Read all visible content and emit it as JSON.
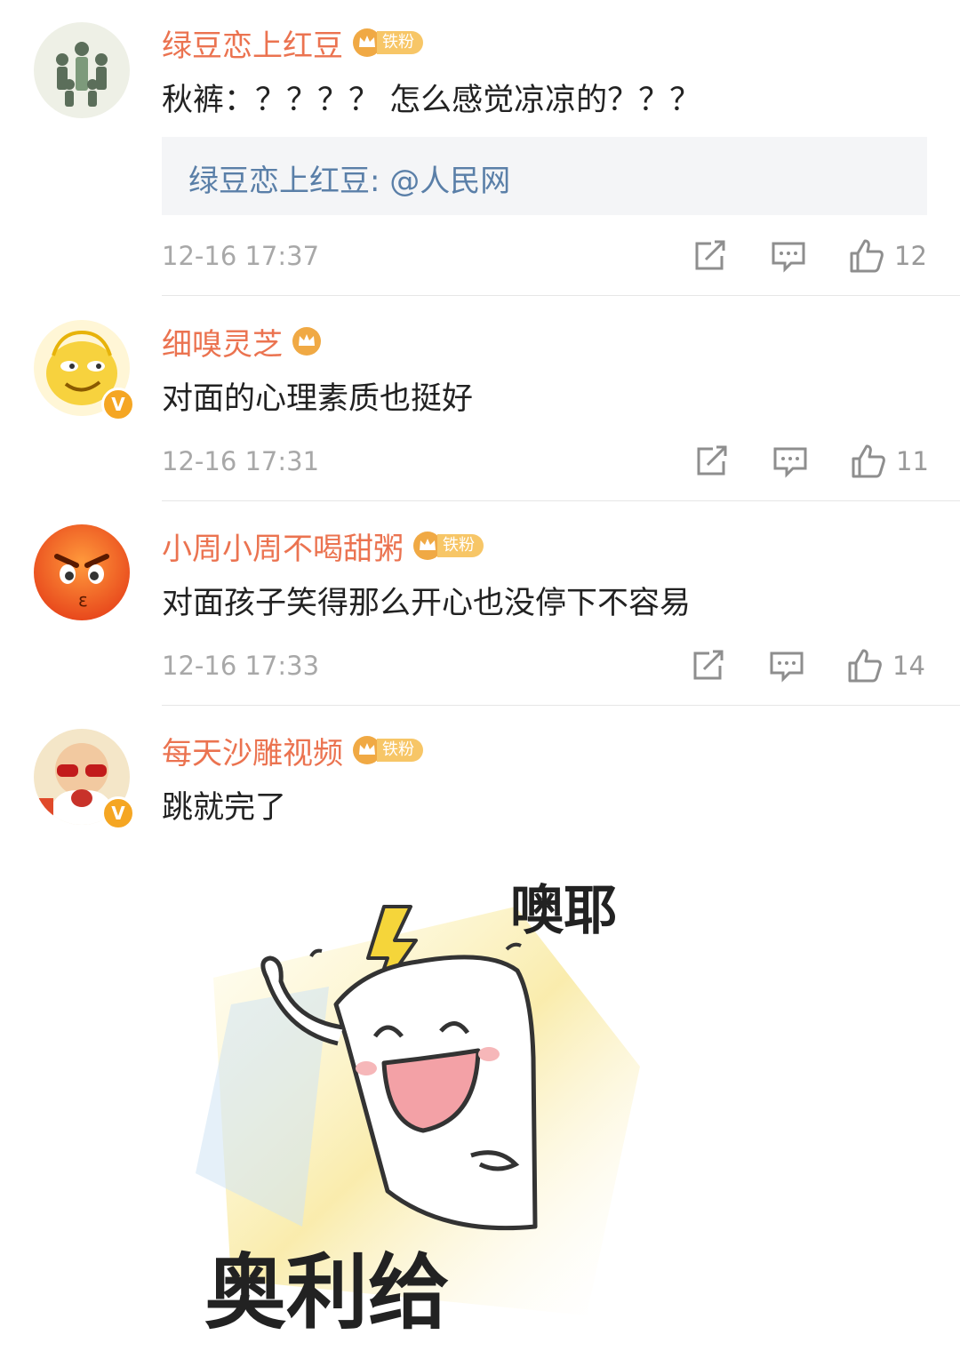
{
  "comments": [
    {
      "username": "绿豆恋上红豆",
      "fan_badge": "铁粉",
      "text": "秋裤：？？？？ 怎么感觉凉凉的？？？",
      "quote": "绿豆恋上红豆: @人民网",
      "time": "12-16 17:37",
      "likes": "12"
    },
    {
      "username": "细嗅灵芝",
      "text": "对面的心理素质也挺好",
      "time": "12-16 17:31",
      "likes": "11"
    },
    {
      "username": "小周小周不喝甜粥",
      "fan_badge": "铁粉",
      "text": "对面孩子笑得那么开心也没停下不容易",
      "time": "12-16 17:33",
      "likes": "14"
    },
    {
      "username": "每天沙雕视频",
      "fan_badge": "铁粉",
      "text": "跳就完了",
      "sticker_top": "噢耶",
      "sticker_bottom": "奥利给"
    }
  ],
  "verified_mark": "V",
  "colors": {
    "username": "#eb7350",
    "quote_text": "#5a7fa8",
    "badge": "#f7c667",
    "meta": "#a8a8a8"
  }
}
